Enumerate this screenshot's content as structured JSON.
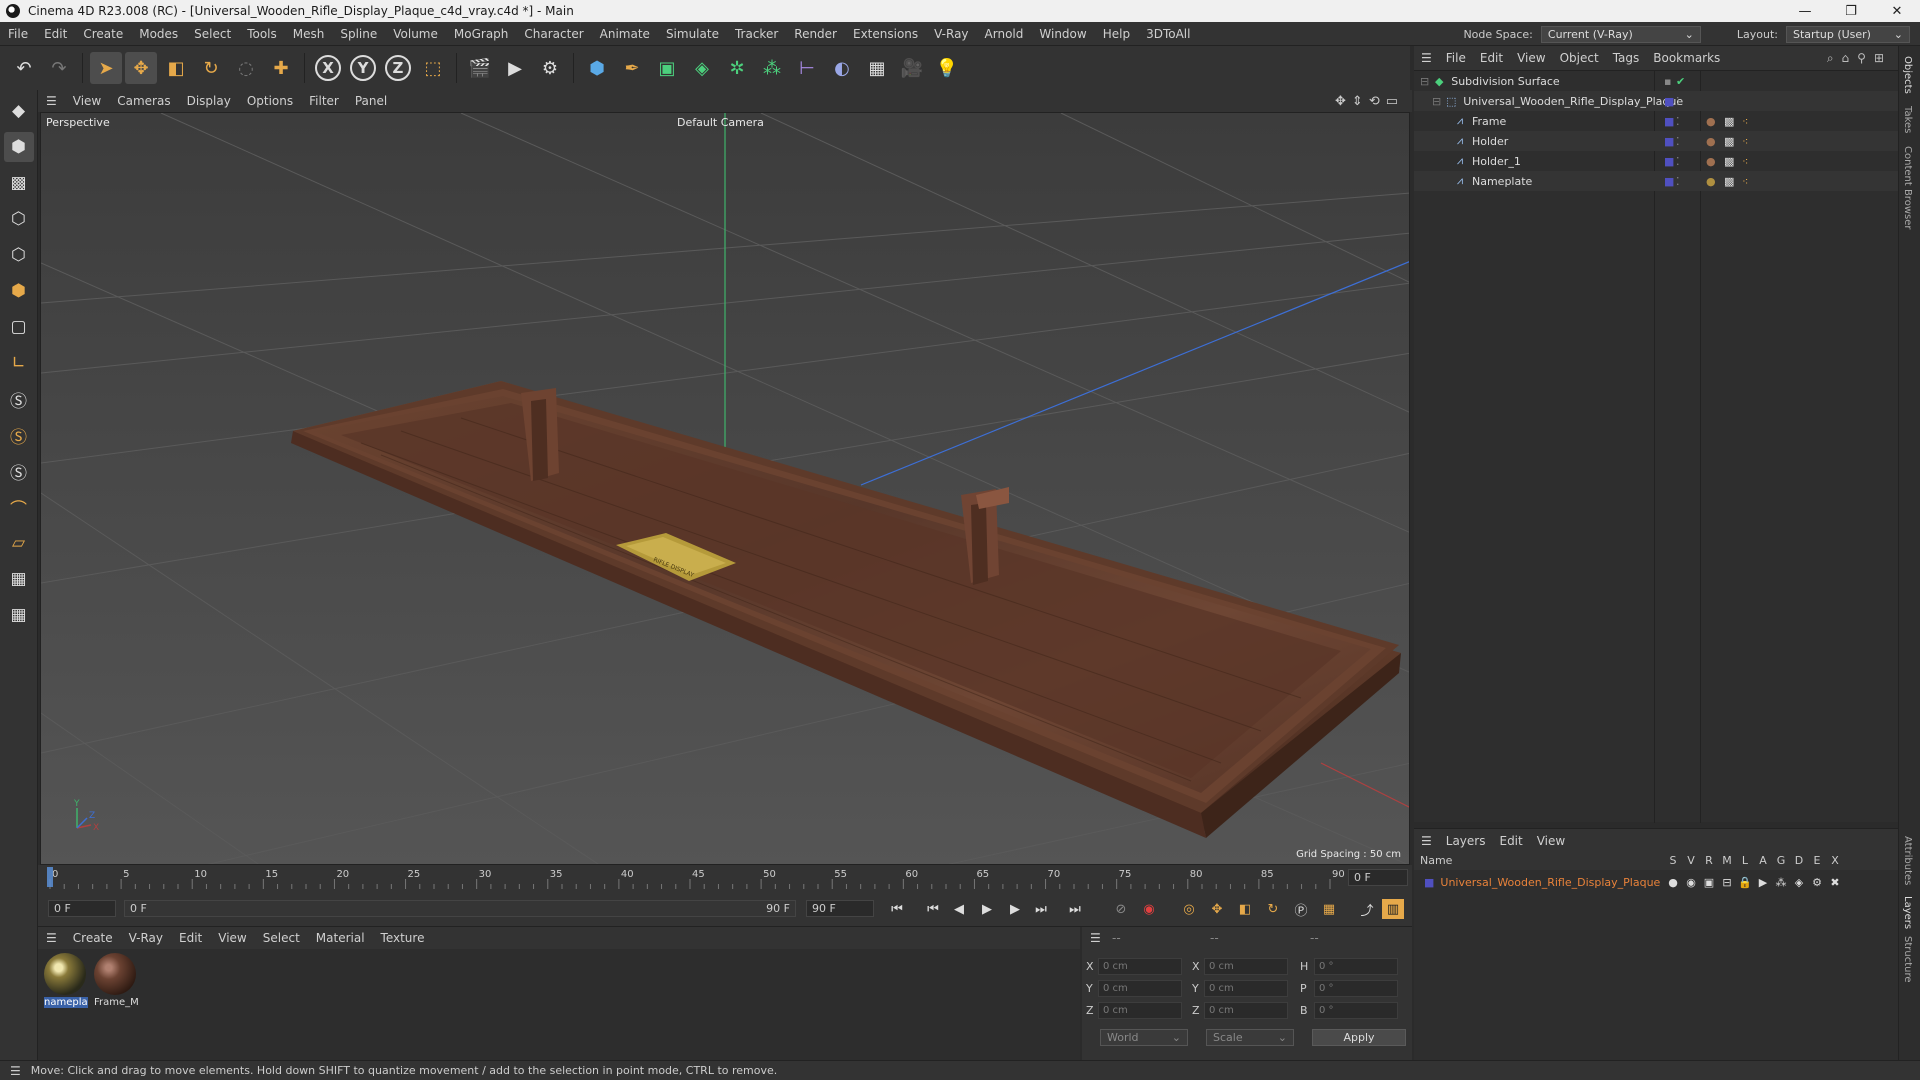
{
  "window": {
    "title": "Cinema 4D R23.008 (RC) - [Universal_Wooden_Rifle_Display_Plaque_c4d_vray.c4d *] - Main",
    "minimize": "—",
    "maximize": "❐",
    "close": "✕"
  },
  "menubar": {
    "items": [
      "File",
      "Edit",
      "Create",
      "Modes",
      "Select",
      "Tools",
      "Mesh",
      "Spline",
      "Volume",
      "MoGraph",
      "Character",
      "Animate",
      "Simulate",
      "Tracker",
      "Render",
      "Extensions",
      "V-Ray",
      "Arnold",
      "Window",
      "Help",
      "3DToAll"
    ],
    "node_space_label": "Node Space:",
    "node_space_value": "Current (V-Ray)",
    "layout_label": "Layout:",
    "layout_value": "Startup (User)"
  },
  "viewport": {
    "menu": [
      "View",
      "Cameras",
      "Display",
      "Options",
      "Filter",
      "Panel"
    ],
    "view_name": "Perspective",
    "camera_name": "Default Camera",
    "grid_spacing": "Grid Spacing : 50 cm",
    "nameplate_text": "RIFLE DISPLAY"
  },
  "timeline": {
    "ticks": [
      "0",
      "5",
      "10",
      "15",
      "20",
      "25",
      "30",
      "35",
      "40",
      "45",
      "50",
      "55",
      "60",
      "65",
      "70",
      "75",
      "80",
      "85",
      "90"
    ],
    "current_frame": "0 F",
    "start_frame": "0 F",
    "range_start": "0 F",
    "range_end": "90 F",
    "end_frame": "90 F"
  },
  "material_manager": {
    "menu": [
      "Create",
      "V-Ray",
      "Edit",
      "View",
      "Select",
      "Material",
      "Texture"
    ],
    "materials": [
      {
        "name": "namepla"
      },
      {
        "name": "Frame_M"
      }
    ]
  },
  "coordinates": {
    "headers": [
      "--",
      "--",
      "--"
    ],
    "rows": [
      {
        "axis": "X",
        "pos": "0 cm",
        "size_axis": "X",
        "size": "0 cm",
        "rot_axis": "H",
        "rot": "0 °"
      },
      {
        "axis": "Y",
        "pos": "0 cm",
        "size_axis": "Y",
        "size": "0 cm",
        "rot_axis": "P",
        "rot": "0 °"
      },
      {
        "axis": "Z",
        "pos": "0 cm",
        "size_axis": "Z",
        "size": "0 cm",
        "rot_axis": "B",
        "rot": "0 °"
      }
    ],
    "mode": "World",
    "transform": "Scale",
    "apply": "Apply"
  },
  "object_manager": {
    "menu": [
      "File",
      "Edit",
      "View",
      "Object",
      "Tags",
      "Bookmarks"
    ],
    "objects": [
      {
        "name": "Subdivision Surface"
      },
      {
        "name": "Universal_Wooden_Rifle_Display_Plaque"
      },
      {
        "name": "Frame"
      },
      {
        "name": "Holder"
      },
      {
        "name": "Holder_1"
      },
      {
        "name": "Nameplate"
      }
    ]
  },
  "layer_manager": {
    "menu": [
      "Layers",
      "Edit",
      "View"
    ],
    "name_header": "Name",
    "flag_headers": [
      "S",
      "V",
      "R",
      "M",
      "L",
      "A",
      "G",
      "D",
      "E",
      "X"
    ],
    "layers": [
      {
        "name": "Universal_Wooden_Rifle_Display_Plaque"
      }
    ]
  },
  "side_tabs": [
    "Objects",
    "Takes",
    "Content Browser",
    "Attributes",
    "Layers",
    "Structure"
  ],
  "status": "Move: Click and drag to move elements. Hold down SHIFT to quantize movement / add to the selection in point mode, CTRL to remove.",
  "colors": {
    "layer_name": "#e8823a",
    "axis_y": "#3fb36b",
    "axis_x": "#b04040",
    "axis_z": "#3d6fd6"
  }
}
